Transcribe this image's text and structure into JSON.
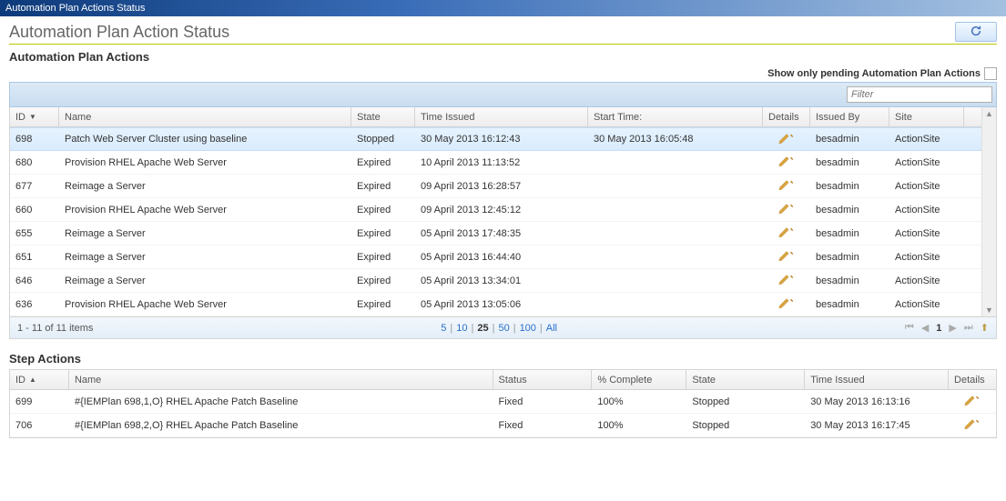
{
  "window_title": "Automation Plan Actions Status",
  "page_header": "Automation Plan Action Status",
  "refresh_icon": "refresh-icon",
  "sections": {
    "main": {
      "title": "Automation Plan Actions",
      "pending_checkbox_label": "Show only pending Automation Plan Actions",
      "filter_placeholder": "Filter",
      "columns": {
        "id": "ID",
        "name": "Name",
        "state": "State",
        "time_issued": "Time Issued",
        "start_time": "Start Time:",
        "details": "Details",
        "issued_by": "Issued By",
        "site": "Site"
      },
      "rows": [
        {
          "id": "698",
          "name": "Patch Web Server Cluster using baseline",
          "state": "Stopped",
          "time_issued": "30 May 2013 16:12:43",
          "start_time": "30 May 2013 16:05:48",
          "issued_by": "besadmin",
          "site": "ActionSite",
          "selected": true
        },
        {
          "id": "680",
          "name": "Provision RHEL Apache Web Server",
          "state": "Expired",
          "time_issued": "10 April 2013 11:13:52",
          "start_time": "",
          "issued_by": "besadmin",
          "site": "ActionSite"
        },
        {
          "id": "677",
          "name": "Reimage a Server",
          "state": "Expired",
          "time_issued": "09 April 2013 16:28:57",
          "start_time": "",
          "issued_by": "besadmin",
          "site": "ActionSite"
        },
        {
          "id": "660",
          "name": "Provision RHEL Apache Web Server",
          "state": "Expired",
          "time_issued": "09 April 2013 12:45:12",
          "start_time": "",
          "issued_by": "besadmin",
          "site": "ActionSite"
        },
        {
          "id": "655",
          "name": "Reimage a Server",
          "state": "Expired",
          "time_issued": "05 April 2013 17:48:35",
          "start_time": "",
          "issued_by": "besadmin",
          "site": "ActionSite"
        },
        {
          "id": "651",
          "name": "Reimage a Server",
          "state": "Expired",
          "time_issued": "05 April 2013 16:44:40",
          "start_time": "",
          "issued_by": "besadmin",
          "site": "ActionSite"
        },
        {
          "id": "646",
          "name": "Reimage a Server",
          "state": "Expired",
          "time_issued": "05 April 2013 13:34:01",
          "start_time": "",
          "issued_by": "besadmin",
          "site": "ActionSite"
        },
        {
          "id": "636",
          "name": "Provision RHEL Apache Web Server",
          "state": "Expired",
          "time_issued": "05 April 2013 13:05:06",
          "start_time": "",
          "issued_by": "besadmin",
          "site": "ActionSite"
        }
      ],
      "footer": {
        "items_text": "1 - 11 of 11 items",
        "page_sizes": [
          "5",
          "10",
          "25",
          "50",
          "100",
          "All"
        ],
        "current_page_size": "25",
        "current_page": "1"
      }
    },
    "steps": {
      "title": "Step Actions",
      "columns": {
        "id": "ID",
        "name": "Name",
        "status": "Status",
        "complete": "% Complete",
        "state": "State",
        "time_issued": "Time Issued",
        "details": "Details"
      },
      "rows": [
        {
          "id": "699",
          "name": "#{IEMPlan 698,1,O} RHEL Apache Patch Baseline",
          "status": "Fixed",
          "complete": "100%",
          "state": "Stopped",
          "time_issued": "30 May 2013 16:13:16"
        },
        {
          "id": "706",
          "name": "#{IEMPlan 698,2,O} RHEL Apache Patch Baseline",
          "status": "Fixed",
          "complete": "100%",
          "state": "Stopped",
          "time_issued": "30 May 2013 16:17:45"
        }
      ]
    }
  }
}
